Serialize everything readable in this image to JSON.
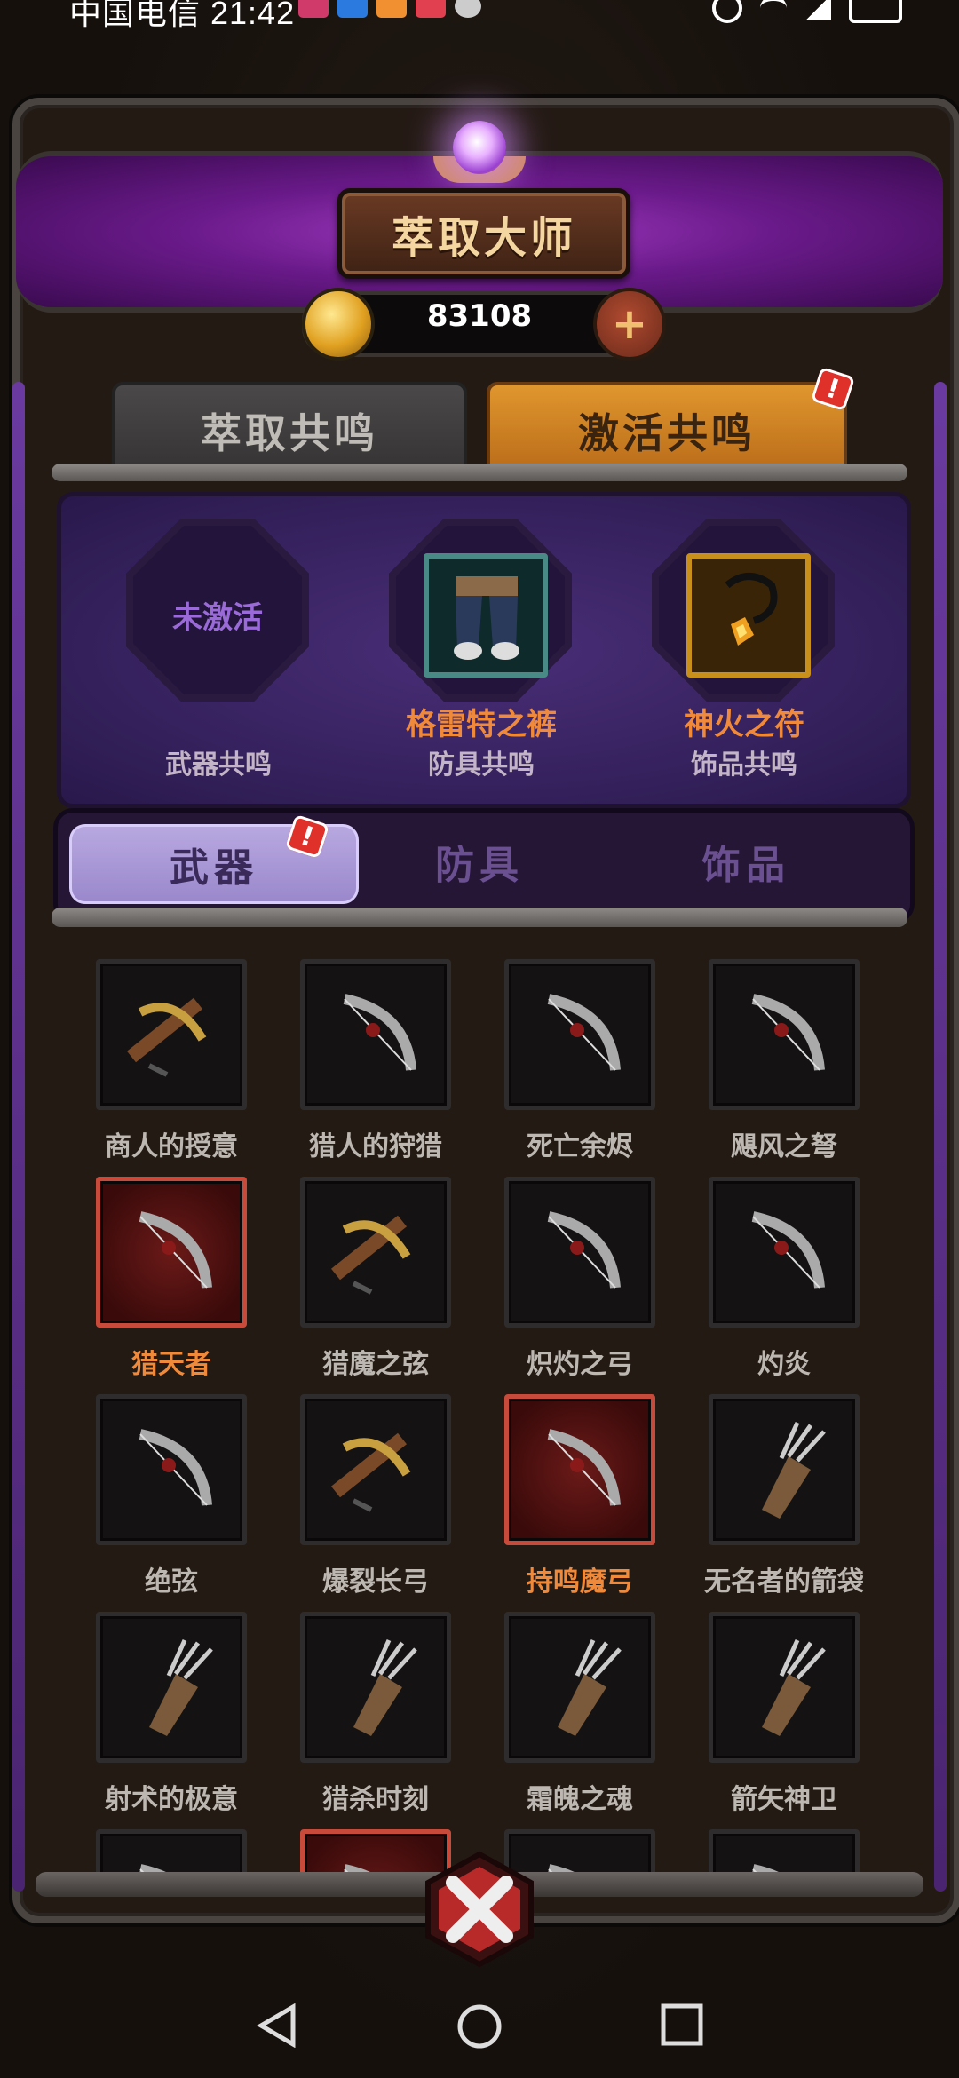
{
  "status_bar": {
    "carrier_time": "中国电信 21:42"
  },
  "header": {
    "title": "萃取大师",
    "currency_value": "83108",
    "add_symbol": "+"
  },
  "top_tabs": [
    {
      "label": "萃取共鸣",
      "active": false
    },
    {
      "label": "激活共鸣",
      "active": true
    }
  ],
  "badge_mark": "!",
  "resonance": {
    "slots": [
      {
        "state_text": "未激活",
        "item_name": "",
        "category": "武器共鸣"
      },
      {
        "state_text": "",
        "item_name": "格雷特之裤",
        "category": "防具共鸣"
      },
      {
        "state_text": "",
        "item_name": "神火之符",
        "category": "饰品共鸣"
      }
    ]
  },
  "category_tabs": [
    {
      "label": "武器",
      "active": true
    },
    {
      "label": "防具",
      "active": false
    },
    {
      "label": "饰品",
      "active": false
    }
  ],
  "items": [
    {
      "name": "商人的授意",
      "highlight": false,
      "icon": "crossbow-icon"
    },
    {
      "name": "猎人的狩猎",
      "highlight": false,
      "icon": "bow-icon"
    },
    {
      "name": "死亡余烬",
      "highlight": false,
      "icon": "bow-icon"
    },
    {
      "name": "飓风之弩",
      "highlight": false,
      "icon": "bow-icon"
    },
    {
      "name": "猎天者",
      "highlight": true,
      "icon": "bow-icon"
    },
    {
      "name": "猎魔之弦",
      "highlight": false,
      "icon": "crossbow-icon"
    },
    {
      "name": "炽灼之弓",
      "highlight": false,
      "icon": "bow-icon"
    },
    {
      "name": "灼炎",
      "highlight": false,
      "icon": "bow-icon"
    },
    {
      "name": "绝弦",
      "highlight": false,
      "icon": "bow-icon"
    },
    {
      "name": "爆裂长弓",
      "highlight": false,
      "icon": "crossbow-icon"
    },
    {
      "name": "持鸣魔弓",
      "highlight": true,
      "icon": "bow-icon"
    },
    {
      "name": "无名者的箭袋",
      "highlight": false,
      "icon": "quiver-icon"
    },
    {
      "name": "射术的极意",
      "highlight": false,
      "icon": "quiver-icon"
    },
    {
      "name": "猎杀时刻",
      "highlight": false,
      "icon": "quiver-icon"
    },
    {
      "name": "霜魄之魂",
      "highlight": false,
      "icon": "quiver-icon"
    },
    {
      "name": "箭矢神卫",
      "highlight": false,
      "icon": "quiver-icon"
    },
    {
      "name": "",
      "highlight": false,
      "icon": "bow-icon"
    },
    {
      "name": "",
      "highlight": true,
      "icon": "bow-icon"
    },
    {
      "name": "",
      "highlight": false,
      "icon": "bow-icon"
    },
    {
      "name": "",
      "highlight": false,
      "icon": "bow-icon"
    }
  ],
  "colors": {
    "accent_orange": "#f08a3a",
    "active_tab": "#e0962e",
    "panel_purple": "#3a2460",
    "highlight_red": "#c84a3a"
  }
}
